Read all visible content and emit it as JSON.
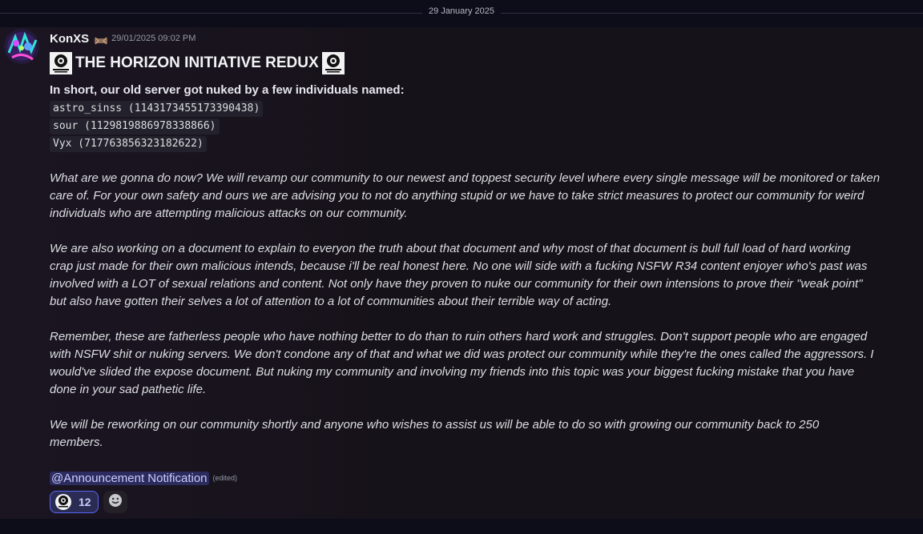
{
  "divider": {
    "date": "29 January 2025"
  },
  "message": {
    "author": "KonXS",
    "badge_icon": "server-tag-icon",
    "timestamp": "29/01/2025 09:02 PM",
    "title": "THE HORIZON INITIATIVE REDUX",
    "logo_icon": "horizon-initiative-logo",
    "intro": "In short, our old server got nuked by a few individuals named:",
    "users": [
      "astro_sinss (1143173455173390438)",
      "sour (1129819886978338866)",
      "Vyx (717763856323182622)"
    ],
    "paragraphs": [
      [
        "What are we gonna do now? We will revamp our community to our newest and toppest security level where every single message will be monitored or taken",
        "care of. For your own safety and ours we are advising you to not do anything stupid or we have to take strict measures to protect our community for weird",
        "individuals who are attempting malicious attacks on our community."
      ],
      [
        "We are also working on a document to explain to everyon the truth about that document and why most of that document is bull full load of hard working",
        "crap just made for their own malicious intends, because i'll be real honest here. No one will side with a fucking NSFW R34 content enjoyer who's past was",
        "involved with a LOT of sexual relations and content. Not only have they proven to nuke our community for their own intensions to prove their \"weak point\"",
        "but also have gotten their selves a lot of attention to a lot of communities about their terrible way of acting."
      ],
      [
        "Remember, these are fatherless people who have nothing better to do than to ruin others hard work and struggles. Don't support people who are engaged",
        "with NSFW shit or nuking servers. We don't condone any of that and what we did was protect our community while they're the ones called the aggressors. I",
        "would've slided the expose document. But nuking my community and involving my friends into this topic was your biggest fucking mistake that you have",
        "done in your sad pathetic life."
      ],
      [
        "We will be reworking on our community shortly and anyone who wishes to assist us will be able to do so with growing our community back to 250",
        "members."
      ]
    ],
    "mention": "@Announcement Notification",
    "edited": "(edited)",
    "reaction": {
      "emoji": "horizon-logo-emoji",
      "count": "12"
    },
    "add_reaction_icon": "smiley-add-reaction-icon"
  },
  "colors": {
    "mention": "#c9cdfb",
    "reaction_border": "#5865f2"
  }
}
